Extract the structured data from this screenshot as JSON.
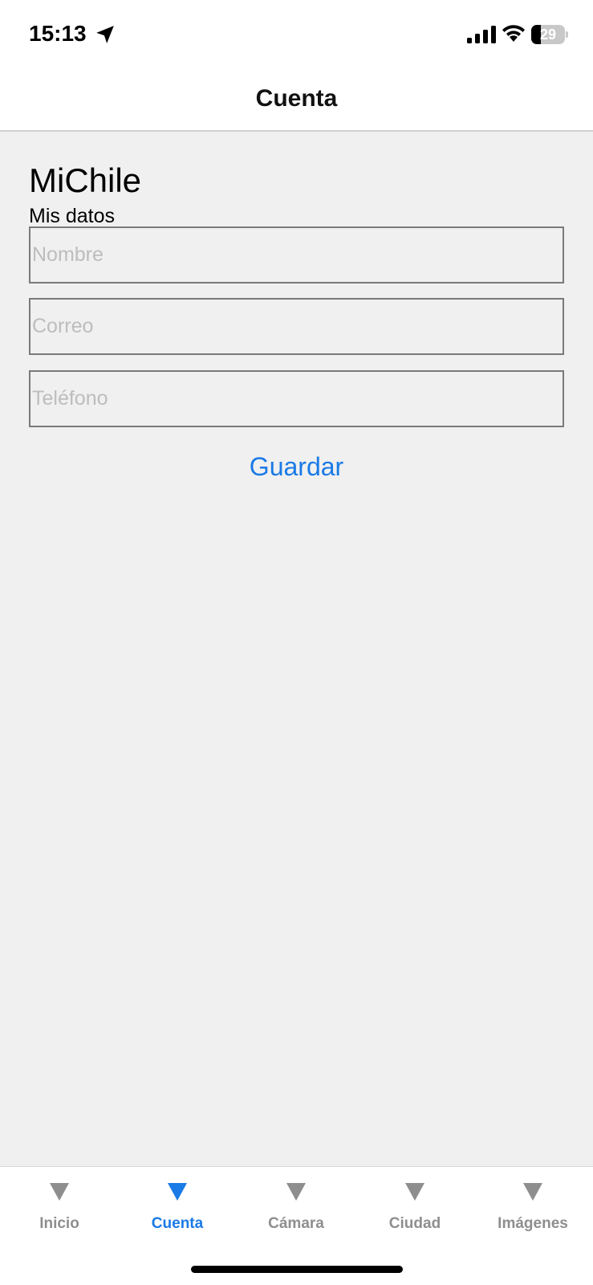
{
  "status_bar": {
    "time": "15:13",
    "battery": 29,
    "icons": [
      "location-arrow-icon",
      "signal-bars-icon",
      "wifi-icon",
      "battery-icon"
    ]
  },
  "nav": {
    "title": "Cuenta"
  },
  "main": {
    "app_title": "MiChile",
    "section_label": "Mis datos",
    "fields": {
      "name": {
        "placeholder": "Nombre",
        "value": ""
      },
      "email": {
        "placeholder": "Correo",
        "value": ""
      },
      "phone": {
        "placeholder": "Teléfono",
        "value": ""
      }
    },
    "save_label": "Guardar"
  },
  "tab_bar": {
    "active": "Cuenta",
    "tabs": [
      {
        "label": "Inicio",
        "icon": "triangle-down-icon"
      },
      {
        "label": "Cuenta",
        "icon": "triangle-down-icon"
      },
      {
        "label": "Cámara",
        "icon": "triangle-down-icon"
      },
      {
        "label": "Ciudad",
        "icon": "triangle-down-icon"
      },
      {
        "label": "Imágenes",
        "icon": "triangle-down-icon"
      }
    ]
  },
  "colors": {
    "accent": "#1a7ae6",
    "inactive": "#8e8e8e",
    "background": "#f0f0f0",
    "placeholder": "#bdbdbd"
  }
}
